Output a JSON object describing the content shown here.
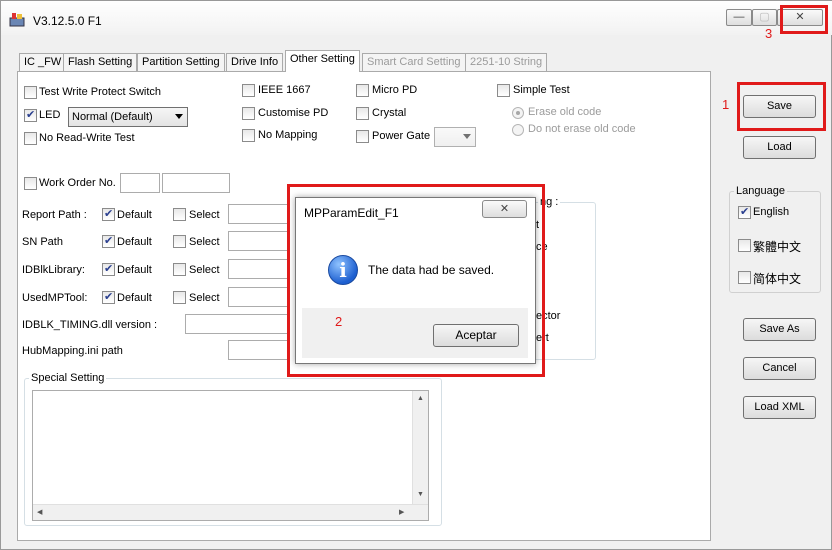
{
  "window": {
    "title": "V3.12.5.0 F1",
    "min_glyph": "—",
    "max_glyph": "▢",
    "close_glyph": "✕"
  },
  "tabs": [
    {
      "label": "IC _FW"
    },
    {
      "label": "Flash Setting"
    },
    {
      "label": "Partition Setting"
    },
    {
      "label": "Drive Info"
    },
    {
      "label": "Other Setting"
    },
    {
      "label": "Smart Card Setting"
    },
    {
      "label": "2251-10 String"
    }
  ],
  "active_tab": "Other Setting",
  "options": {
    "test_write_protect": {
      "label": "Test Write Protect Switch",
      "checked": false
    },
    "led": {
      "label": "LED",
      "checked": true,
      "mode": "Normal (Default)"
    },
    "no_read_write": {
      "label": "No Read-Write Test",
      "checked": false
    },
    "ieee_1667": {
      "label": "IEEE 1667",
      "checked": false
    },
    "customise_pd": {
      "label": "Customise PD",
      "checked": false
    },
    "no_mapping": {
      "label": "No Mapping",
      "checked": false
    },
    "micro_pd": {
      "label": "Micro PD",
      "checked": false
    },
    "crystal": {
      "label": "Crystal",
      "checked": false
    },
    "power_gate": {
      "label": "Power Gate",
      "checked": false
    },
    "simple_test": {
      "label": "Simple Test",
      "checked": false
    },
    "erase_old_code": {
      "label": "Erase old code",
      "checked": true
    },
    "not_erase_old_code": {
      "label": "Do not erase old code",
      "checked": false
    },
    "work_order_no": {
      "label": "Work Order No.",
      "checked": false
    }
  },
  "paths": [
    {
      "label": "Report Path :",
      "default_label": "Default",
      "select_label": "Select",
      "default_checked": true
    },
    {
      "label": "SN Path",
      "default_label": "Default",
      "select_label": "Select",
      "default_checked": true
    },
    {
      "label": "IDBlkLibrary:",
      "default_label": "Default",
      "select_label": "Select",
      "default_checked": true
    },
    {
      "label": "UsedMPTool:",
      "default_label": "Default",
      "select_label": "Select",
      "default_checked": true
    }
  ],
  "idblk_timing_label": "IDBLK_TIMING.dll version :",
  "hubmapping_label": "HubMapping.ini path",
  "special_setting": {
    "title": "Special Setting",
    "text": ""
  },
  "hidden_group": {
    "title_fragment": "ng :",
    "line1": "t",
    "line2": "ce",
    "line3": "ector",
    "line4": "ert"
  },
  "side_buttons": {
    "save": "Save",
    "load": "Load",
    "save_as": "Save As",
    "cancel": "Cancel",
    "load_xml": "Load XML"
  },
  "language": {
    "title": "Language",
    "items": [
      {
        "label": "English",
        "checked": true
      },
      {
        "label": "繁體中文",
        "checked": false
      },
      {
        "label": "简体中文",
        "checked": false
      }
    ]
  },
  "dialog": {
    "title": "MPParamEdit_F1",
    "message": "The data had be saved.",
    "button": "Aceptar",
    "close_glyph": "✕",
    "icon_glyph": "i"
  },
  "annotations": {
    "one": "1",
    "two": "2",
    "three": "3"
  },
  "colors": {
    "highlight": "#e01a1a",
    "info_blue": "#1d5fd0"
  }
}
